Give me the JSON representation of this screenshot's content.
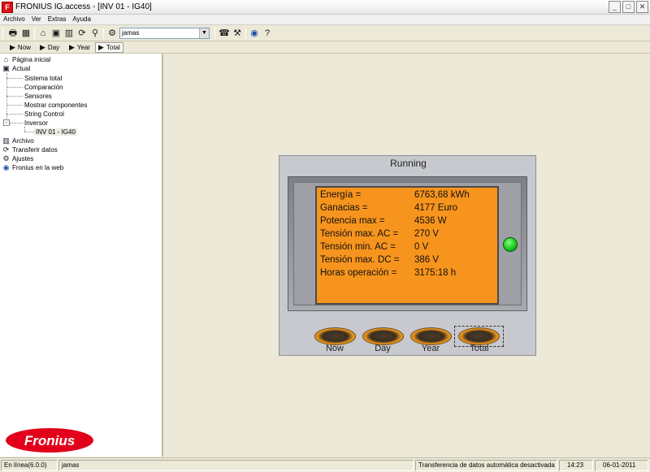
{
  "window": {
    "app_icon": "fronius-app-icon",
    "title": "FRONIUS IG.access - [INV 01 - IG40]",
    "controls": [
      "minimize",
      "maximize",
      "close"
    ]
  },
  "menu": {
    "items": [
      "Archivo",
      "Ver",
      "Extras",
      "Ayuda"
    ]
  },
  "toolbar": {
    "icons": [
      "print-icon",
      "export-icon",
      "home-icon",
      "display-icon",
      "bar-chart-icon",
      "transfer-icon",
      "search-icon",
      "settings-icon",
      "phone-icon",
      "tool-icon",
      "globe-icon",
      "help-icon"
    ],
    "plant_select": {
      "value": "jamas"
    }
  },
  "viewbar": {
    "buttons": [
      {
        "label": "Now",
        "active": false
      },
      {
        "label": "Day",
        "active": false
      },
      {
        "label": "Year",
        "active": false
      },
      {
        "label": "Total",
        "active": true
      }
    ]
  },
  "tree": {
    "items": [
      {
        "label": "Página inicial",
        "icon": "home-icon"
      },
      {
        "label": "Actual",
        "icon": "display-icon"
      },
      {
        "label": "Sistema total"
      },
      {
        "label": "Comparación"
      },
      {
        "label": "Sensores"
      },
      {
        "label": "Mostrar componentes"
      },
      {
        "label": "String Control"
      },
      {
        "label": "Inversor",
        "expander": "-"
      },
      {
        "label": "INV 01 - IG40",
        "selected": true
      },
      {
        "label": "Archivo",
        "icon": "bar-chart-icon"
      },
      {
        "label": "Transferir datos",
        "icon": "transfer-icon"
      },
      {
        "label": "Ajustes",
        "icon": "settings-icon"
      },
      {
        "label": "Fronius en la web",
        "icon": "globe-icon"
      }
    ],
    "logo_text": "Fronius"
  },
  "device": {
    "status": "Running",
    "led_color": "#1fd11f",
    "screen_color": "#f7941d",
    "readings": [
      {
        "label": "Energía =",
        "value": "6763,68 kWh"
      },
      {
        "label": "Ganacias =",
        "value": "4177 Euro"
      },
      {
        "label": "Potencia max =",
        "value": "4536 W"
      },
      {
        "label": "Tensión max. AC =",
        "value": "270 V"
      },
      {
        "label": "Tensión min. AC =",
        "value": "0 V"
      },
      {
        "label": "Tensión max. DC =",
        "value": "386 V"
      },
      {
        "label": "Horas operación =",
        "value": "3175:18 h"
      }
    ],
    "buttons": [
      {
        "label": "Now"
      },
      {
        "label": "Day"
      },
      {
        "label": "Year"
      },
      {
        "label": "Total",
        "focused": true
      }
    ]
  },
  "statusbar": {
    "connection": "En línea(6.0.0)",
    "plant": "jamas",
    "transfer_status": "Transferencia de datos automática desactivada",
    "time": "14:23",
    "date": "06-01-2011"
  }
}
